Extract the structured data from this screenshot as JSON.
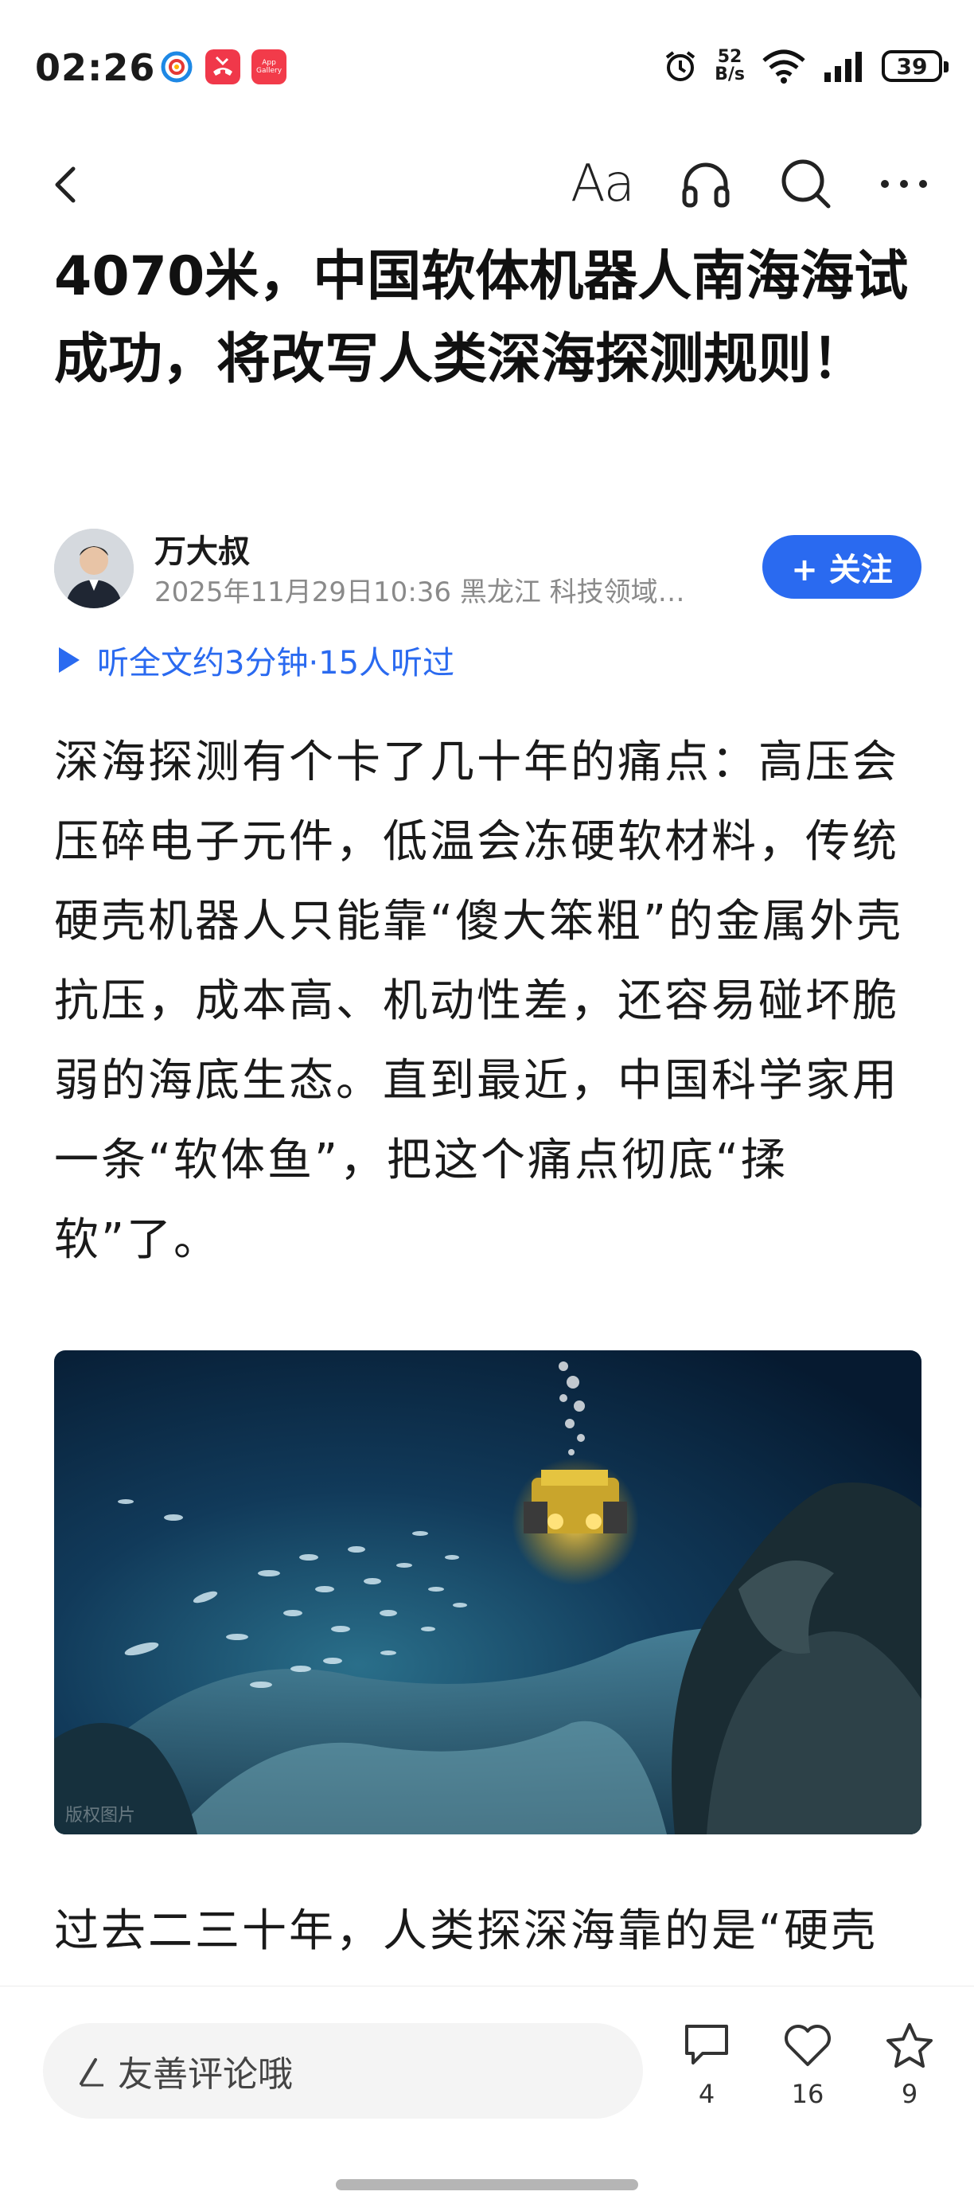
{
  "status_bar": {
    "time": "02:26",
    "net_speed_value": "52",
    "net_speed_unit": "B/s",
    "battery": "39",
    "icons": [
      "app-icon-blue-circle",
      "missed-call-icon",
      "app-gallery-icon",
      "alarm-icon",
      "wifi-icon",
      "signal-icon",
      "battery-icon"
    ]
  },
  "toolbar": {
    "font_label": "Aa",
    "icons": [
      "back-icon",
      "font-size-icon",
      "headphones-icon",
      "search-icon",
      "more-icon"
    ]
  },
  "article": {
    "title": "4070米，中国软体机器人南海海试成功，将改写人类深海探测规则！",
    "author": {
      "name": "万大叔",
      "meta": "2025年11月29日10:36 黑龙江 科技领域…",
      "follow_label": "+ 关注"
    },
    "listen_label": "听全文约3分钟·15人听过",
    "paragraph_1": "深海探测有个卡了几十年的痛点：高压会压碎电子元件，低温会冻硬软材料，传统硬壳机器人只能靠“傻大笨粗”的金属外壳抗压，成本高、机动性差，还容易碰坏脆弱的海底生态。直到最近，中国科学家用一条“软体鱼”，把这个痛点彻底“揉软”了。",
    "image_watermark": "版权图片",
    "paragraph_2": "过去二三十年，人类探深海靠的是“硬壳"
  },
  "bottom_bar": {
    "comment_placeholder": "友善评论哦",
    "comments_count": "4",
    "likes_count": "16",
    "favorites_count": "9"
  },
  "colors": {
    "accent": "#2a6af0",
    "text": "#1a1a1a",
    "meta": "#8a8a8a"
  }
}
